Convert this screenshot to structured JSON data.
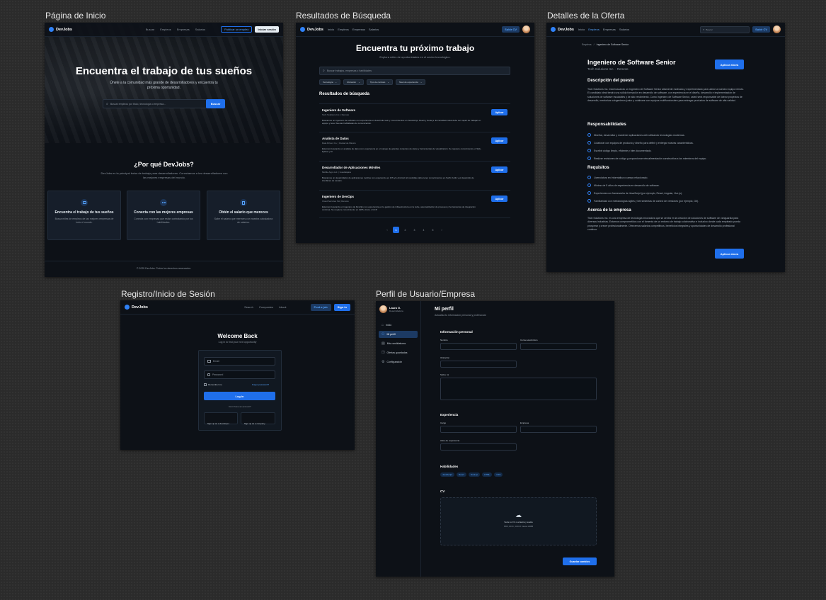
{
  "labels": {
    "home": "Página de Inicio",
    "search": "Resultados de Búsqueda",
    "detail": "Detalles de la Oferta",
    "auth": "Registro/Inicio de Sesión",
    "profile": "Perfil de Usuario/Empresa"
  },
  "brand": "DevJobs",
  "home": {
    "nav": [
      "Buscar",
      "Empleos",
      "Empresas",
      "Salarios"
    ],
    "publish": "Publicar un empleo",
    "login": "Iniciar sesión",
    "hero_title": "Encuentra el trabajo de tus sueños",
    "hero_sub": "Únete a la comunidad más grande de desarrolladores y encuentra tu próxima oportunidad.",
    "search_ph": "Buscar empleos por título, tecnología o empresa...",
    "search_btn": "Buscar",
    "why_title": "¿Por qué DevJobs?",
    "why_sub": "DevJobs es la principal bolsa de trabajo para desarrolladores. Conectamos a los desarrolladores con las mejores empresas del mundo.",
    "features": [
      {
        "title": "Encuentra el trabajo de tus sueños",
        "desc": "Busca miles de empleos de las mejores empresas de todo el mundo.",
        "icon": "briefcase-icon"
      },
      {
        "title": "Conecta con las mejores empresas",
        "desc": "Conecta con empresas que están contratando por tus habilidades.",
        "icon": "people-icon"
      },
      {
        "title": "Obtén el salario que mereces",
        "desc": "Sabe el salario que mereces con nuestra calculadora de salarios.",
        "icon": "building-icon"
      }
    ],
    "footer": "© 2025 DevJobs. Todos los derechos reservados."
  },
  "search": {
    "nav": [
      "Inicio",
      "Empleos",
      "Empresas",
      "Salarios"
    ],
    "upload": "Subir CV",
    "title": "Encuentra tu próximo trabajo",
    "sub": "Explora miles de oportunidades en el sector tecnológico.",
    "search_ph": "Buscar trabajos, empresas o habilidades",
    "filters": [
      "Tecnología",
      "Ubicación",
      "Tipo de contrato",
      "Nivel de experiencia"
    ],
    "results_title": "Resultados de búsqueda",
    "apply": "Aplicar",
    "jobs": [
      {
        "title": "Ingeniero de Software",
        "meta": "Tech Solutions Inc. | Remoto",
        "desc": "Buscamos un ingeniero de software con experiencia en desarrollo web y conocimientos en JavaScript, React y Node.js. El candidato ideal debe ser capaz de trabajar en equipo y tener buenas habilidades de comunicación."
      },
      {
        "title": "Analista de Datos",
        "meta": "Data Driven Co. | Ciudad de México",
        "desc": "Estamos buscando un analista de datos con experiencia en el manejo de grandes conjuntos de datos y herramientas de visualización. Se requiere conocimiento en SQL, Python y R."
      },
      {
        "title": "Desarrollador de Aplicaciones Móviles",
        "meta": "Mobile Apps Ltd. | Guadalajara",
        "desc": "Buscamos un desarrollador de aplicaciones móviles con experiencia en iOS y/o Android. El candidato debe tener conocimientos en Swift, Kotlin y el desarrollo de interfaces de usuario."
      },
      {
        "title": "Ingeniero de DevOps",
        "meta": "Cloud Services SA | Remoto",
        "desc": "Estamos buscando un ingeniero de DevOps con experiencia en la gestión de infraestructura en la nube, automatización de procesos y herramientas de integración continua. Se requiere conocimiento en AWS, Azure o GCP."
      }
    ],
    "pages": [
      "‹",
      "1",
      "2",
      "3",
      "4",
      "5",
      "›"
    ]
  },
  "detail": {
    "nav": [
      "Inicio",
      "Empleos",
      "Empresas",
      "Salarios"
    ],
    "search_ph": "Buscar",
    "upload": "Subir CV",
    "crumb_root": "Empleos",
    "crumb_sep": "/",
    "crumb_current": "Ingeniero de Software Senior",
    "title": "Ingeniero de Software Senior",
    "company": "Tech Solutions Inc. · Remoto",
    "apply": "Aplicar ahora",
    "desc_h": "Descripción del puesto",
    "desc": "Tech Solutions Inc. está buscando un Ingeniero de Software Senior altamente motivado y experimentado para unirse a nuestro equipo remoto. El candidato ideal tendrá una sólida formación en desarrollo de software, con experiencia en el diseño, desarrollo e implementación de soluciones de software escalables y de alto rendimiento. Como Ingeniero de Software Senior, usted será responsable de liderar proyectos de desarrollo, mentorizar a ingenieros junior y colaborar con equipos multifuncionales para entregar productos de software de alta calidad.",
    "resp_h": "Responsabilidades",
    "resp": [
      "Diseñar, desarrollar y mantener aplicaciones web utilizando tecnologías modernas.",
      "Colaborar con equipos de producto y diseño para definir y entregar nuevas características.",
      "Escribir código limpio, eficiente y bien documentado.",
      "Realizar revisiones de código y proporcionar retroalimentación constructiva a los miembros del equipo."
    ],
    "req_h": "Requisitos",
    "req": [
      "Licenciatura en Informática o campo relacionado.",
      "Mínimo de 5 años de experiencia en desarrollo de software.",
      "Experiencia con frameworks de JavaScript (por ejemplo, React, Angular, Vue.js).",
      "Familiaridad con metodologías ágiles y herramientas de control de versiones (por ejemplo, Git)."
    ],
    "about_h": "Acerca de la empresa",
    "about": "Tech Solutions Inc. es una empresa de tecnología innovadora que se centra en la creación de soluciones de software de vanguardia para diversas industrias. Estamos comprometidos con el fomento de un entorno de trabajo colaborativo e inclusivo donde cada empleado pueda prosperar y crecer profesionalmente. Ofrecemos salarios competitivos, beneficios integrales y oportunidades de desarrollo profesional continuo.",
    "apply2": "Aplicar ahora"
  },
  "auth": {
    "nav": [
      "Search",
      "Companies",
      "About"
    ],
    "post": "Post a job",
    "signin": "Sign in",
    "title": "Welcome Back",
    "sub": "Log in to find your next opportunity",
    "email_ph": "Email",
    "password_ph": "Password",
    "remember": "Remember me",
    "forgot": "Forgot password?",
    "login": "Log in",
    "no_account": "Don't have an account?",
    "signup_dev": "Sign up as a developer",
    "signup_company": "Sign up as a company"
  },
  "profile": {
    "user_name": "Laura G.",
    "user_role": "Desarrolladora",
    "side": [
      {
        "label": "Inicio",
        "icon": "home-icon"
      },
      {
        "label": "Mi perfil",
        "icon": "user-icon"
      },
      {
        "label": "Mis candidaturas",
        "icon": "document-icon"
      },
      {
        "label": "Ofertas guardadas",
        "icon": "bookmark-icon"
      },
      {
        "label": "Configuración",
        "icon": "gear-icon"
      }
    ],
    "title": "Mi perfil",
    "sub": "Actualiza tu información personal y profesional",
    "personal_h": "Información personal",
    "f_name": "Nombre",
    "f_email": "Correo electrónico",
    "f_location": "Ubicación",
    "f_about": "Sobre mí",
    "exp_h": "Experiencia",
    "f_role": "Cargo",
    "f_company": "Empresa",
    "f_years": "Años de experiencia",
    "skills_h": "Habilidades",
    "skills": [
      "JavaScript",
      "React",
      "Node.js",
      "HTML",
      "CSS"
    ],
    "cv_h": "CV",
    "cv_upload": "Sube tu CV o arrastra y suelta",
    "cv_hint": "PDF, DOC, DOCX hasta 10MB",
    "save": "Guardar cambios"
  },
  "colors": {
    "accent": "#1f6feb",
    "bg": "#0d1117",
    "card": "#161e2a"
  }
}
